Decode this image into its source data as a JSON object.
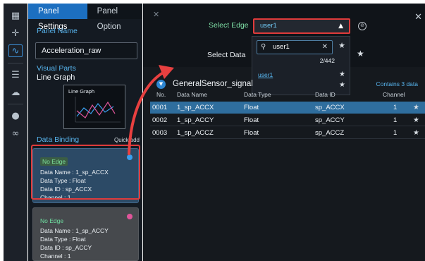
{
  "rail": {
    "icons": [
      "dashboard-icon",
      "align-icon",
      "chart-icon",
      "list-icon",
      "cloud-icon",
      "user-icon",
      "link-icon"
    ]
  },
  "panel": {
    "tabs": [
      {
        "label": "Panel Settings",
        "active": true
      },
      {
        "label": "Panel Option",
        "active": false
      }
    ],
    "panel_name_label": "Panel Name",
    "panel_name_value": "Acceleration_raw",
    "visual_parts_label": "Visual Parts",
    "visual_parts_value": "Line Graph",
    "preview_title": "Line Graph",
    "data_binding_label": "Data Binding",
    "quick_add_label": "Quick add",
    "cards": [
      {
        "edge": "No Edge",
        "data_name": "Data Name : 1_sp_ACCX",
        "data_type": "Data Type : Float",
        "data_id": "Data ID : sp_ACCX",
        "channel": "Channel : 1",
        "dot_color": "#3aa0f0"
      },
      {
        "edge": "No Edge",
        "data_name": "Data Name : 1_sp_ACCY",
        "data_type": "Data Type : Float",
        "data_id": "Data ID : sp_ACCY",
        "channel": "Channel : 1",
        "dot_color": "#e0559a"
      }
    ]
  },
  "dialog": {
    "select_edge_label": "Select Edge",
    "select_edge_value": "user1",
    "select_data_label": "Select Data",
    "search_value": "user1",
    "result_count": "2/442",
    "options": [
      "user1",
      ""
    ],
    "group_name": "GeneralSensor_signal",
    "contains_label": "Contains 3 data",
    "columns": {
      "no": "No.",
      "name": "Data Name",
      "type": "Data Type",
      "id": "Data ID",
      "channel": "Channel"
    },
    "rows": [
      {
        "no": "0001",
        "name": "1_sp_ACCX",
        "type": "Float",
        "id": "sp_ACCX",
        "channel": "1",
        "selected": true
      },
      {
        "no": "0002",
        "name": "1_sp_ACCY",
        "type": "Float",
        "id": "sp_ACCY",
        "channel": "1",
        "selected": false
      },
      {
        "no": "0003",
        "name": "1_sp_ACCZ",
        "type": "Float",
        "id": "sp_ACCZ",
        "channel": "1",
        "selected": false
      }
    ]
  },
  "colors": {
    "accent_blue": "#1c6fc0",
    "highlight_red": "#e03b3b",
    "edge_green": "#7fe0a6",
    "link_blue": "#58b6f0"
  }
}
